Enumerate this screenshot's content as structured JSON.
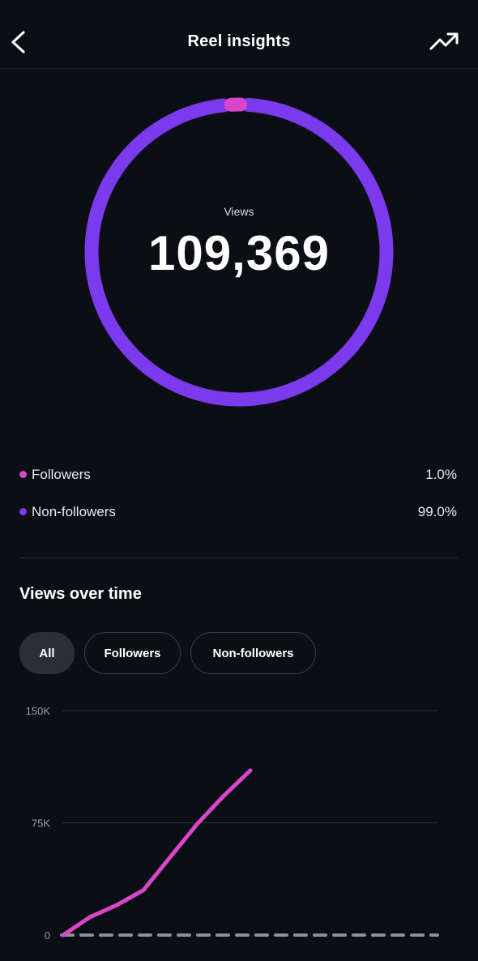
{
  "header": {
    "title": "Reel insights",
    "back_icon": "chevron-left-icon",
    "trend_icon": "trending-up-icon"
  },
  "summary": {
    "label": "Views",
    "value": "109,369",
    "colors": {
      "followers": "#d946c8",
      "non_followers": "#7c3aed"
    }
  },
  "legend": [
    {
      "name": "Followers",
      "pct": "1.0%",
      "value": 1.0,
      "color": "#d946c8"
    },
    {
      "name": "Non-followers",
      "pct": "99.0%",
      "value": 99.0,
      "color": "#7c3aed"
    }
  ],
  "section": {
    "title": "Views over time"
  },
  "filters": [
    {
      "label": "All",
      "active": true
    },
    {
      "label": "Followers",
      "active": false
    },
    {
      "label": "Non-followers",
      "active": false
    }
  ],
  "chart_data": {
    "type": "line",
    "ytick_labels": [
      "150K",
      "75K",
      "0"
    ],
    "ylim": [
      0,
      150000
    ],
    "grid": true,
    "series": [
      {
        "values": [
          0,
          12000,
          20000,
          30000,
          52000,
          74000,
          93000,
          110000
        ],
        "color": "#d946c8",
        "style": "solid"
      },
      {
        "values": [
          0,
          0,
          0,
          0,
          0,
          0,
          0,
          0,
          0,
          0,
          0,
          0,
          0,
          0,
          0,
          0
        ],
        "color": "#8e9098",
        "style": "dashed"
      }
    ]
  }
}
